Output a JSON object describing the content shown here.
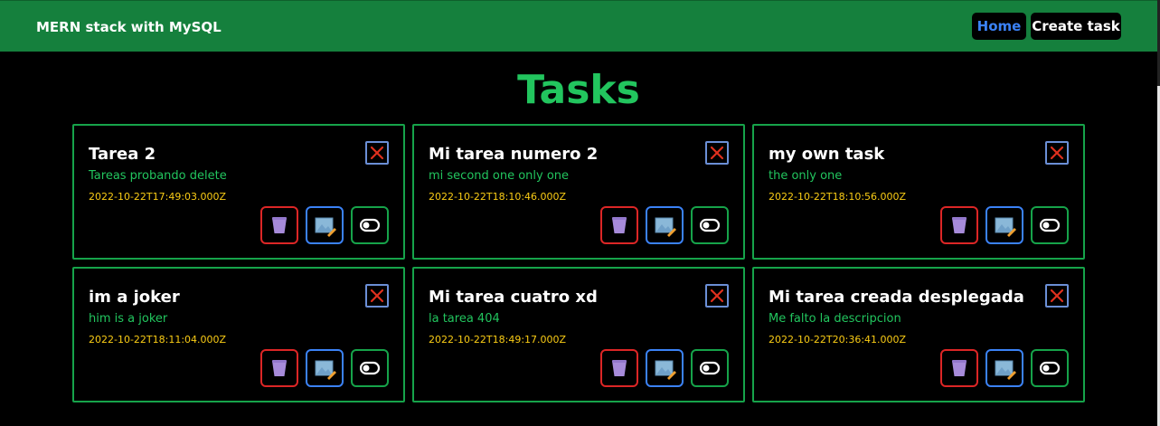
{
  "navbar": {
    "brand": "MERN stack with MySQL",
    "home_label": "Home",
    "create_label": "Create task"
  },
  "page": {
    "title": "Tasks"
  },
  "icons": {
    "close": "close-x-icon",
    "delete": "trash-icon",
    "edit": "edit-image-icon",
    "toggle": "toggle-switch-icon"
  },
  "colors": {
    "navbar": "#15803d",
    "title": "#22c55e",
    "card_border": "#16a34a",
    "description": "#22c55e",
    "date": "#facc15",
    "delete_border": "#dc2626",
    "edit_border": "#3b82f6",
    "close_x": "#e0301e"
  },
  "tasks": [
    {
      "title": "Tarea 2",
      "description": "Tareas probando delete",
      "date": "2022-10-22T17:49:03.000Z"
    },
    {
      "title": "Mi tarea numero 2",
      "description": "mi second one only one",
      "date": "2022-10-22T18:10:46.000Z"
    },
    {
      "title": "my own task",
      "description": "the only one",
      "date": "2022-10-22T18:10:56.000Z"
    },
    {
      "title": "im a joker",
      "description": "him is a joker",
      "date": "2022-10-22T18:11:04.000Z"
    },
    {
      "title": "Mi tarea cuatro xd",
      "description": "la tarea 404",
      "date": "2022-10-22T18:49:17.000Z"
    },
    {
      "title": "Mi tarea creada desplegada",
      "description": "Me falto la descripcion",
      "date": "2022-10-22T20:36:41.000Z"
    }
  ]
}
